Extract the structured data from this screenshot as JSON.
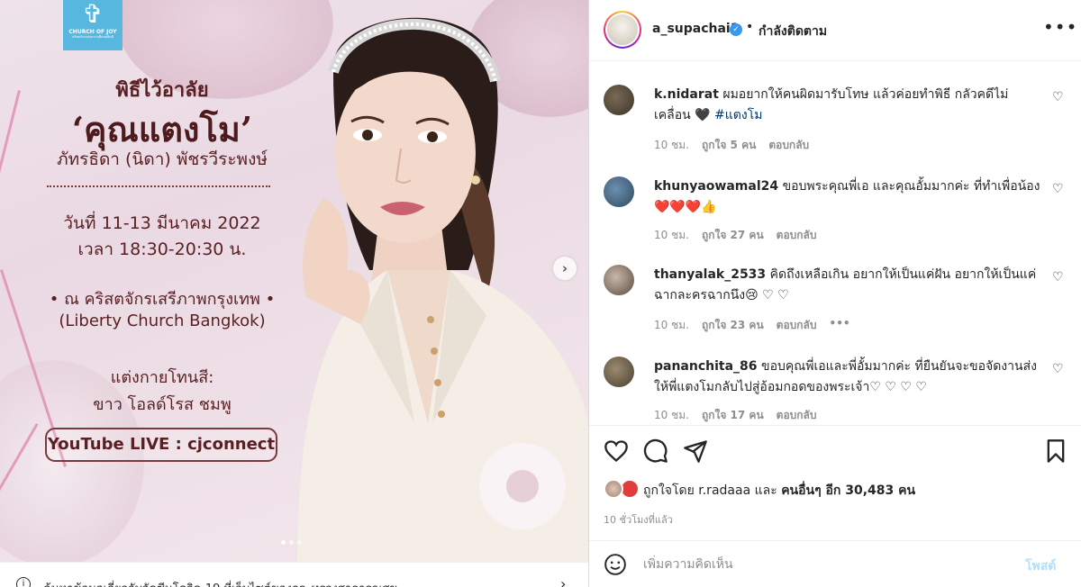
{
  "poster": {
    "logo_text": "CHURCH OF JOY",
    "logo_sub": "คริสตจักรแห่งความชื่นชมยินดี",
    "title_small": "พิธีไว้อาลัย",
    "title_big": "‘คุณแตงโม’",
    "full_name": "ภัทรธิดา (นิดา) พัชรวีระพงษ์",
    "date_line": "วันที่ 11-13 มีนาคม 2022",
    "time_line": "เวลา 18:30-20:30 น.",
    "venue_th": "• ณ คริสตจักรเสรีภาพกรุงเทพ •",
    "venue_en": "(Liberty Church Bangkok)",
    "dress_label": "แต่งกายโทนสี:",
    "dress_colors": "ขาว โอลด์โรส ชมพู",
    "youtube": "YouTube LIVE : cjconnect"
  },
  "bottom_notice": {
    "text": "ค้นหาข้อมูลเกี่ยวกับวัคซีนโควิด-19 ที่เว็บไซต์ของกระทรวงสาธารณสุข"
  },
  "header": {
    "username": "a_supachai1",
    "separator": "•",
    "follow_label": "กำลังติดตาม",
    "more": "•••"
  },
  "comments": [
    {
      "username": "k.nidarat",
      "text": "ผมอยากให้คนผิดมารับโทษ แล้วค่อยทำพิธี กลัวคดีไม่เคลื่อน 🖤",
      "hashtag": "#แตงโม",
      "time": "10 ชม.",
      "likes": "ถูกใจ 5 คน",
      "reply": "ตอบกลับ"
    },
    {
      "username": "khunyaowamal24",
      "text": "ขอบพระคุณพี่เอ และคุณอั้มมากค่ะ ที่ทำเพื่อน้อง",
      "emoji_line": "❤️❤️❤️👍",
      "time": "10 ชม.",
      "likes": "ถูกใจ 27 คน",
      "reply": "ตอบกลับ"
    },
    {
      "username": "thanyalak_2533",
      "text": "คิดถึงเหลือเกิน อยากให้เป็นแค่ฝัน อยากให้เป็นแค่ฉากละครฉากนึง😢 ♡ ♡",
      "time": "10 ชม.",
      "likes": "ถูกใจ 23 คน",
      "reply": "ตอบกลับ",
      "more": "•••"
    },
    {
      "username": "pananchita_86",
      "text": "ขอบคุณพี่เอและพี่อั้มมากค่ะ ที่ยืนยันจะขอจัดงานส่งให้พี่แตงโมกลับไปสู่อ้อมกอดของพระเจ้า♡ ♡ ♡ ♡",
      "time": "10 ชม.",
      "likes": "ถูกใจ 17 คน",
      "reply": "ตอบกลับ"
    }
  ],
  "likes_summary": {
    "prefix": "ถูกใจโดย",
    "user": "r.radaaa",
    "conj": "และ",
    "others": "คนอื่นๆ อีก 30,483 คน"
  },
  "time_ago": "10 ชั่วโมงที่แล้ว",
  "add_comment": {
    "placeholder": "เพิ่มความคิดเห็น",
    "post_label": "โพสต์"
  },
  "colors": {
    "verified": "#3897f0",
    "link": "#00376b",
    "post_btn_disabled": "#b2dffc"
  }
}
